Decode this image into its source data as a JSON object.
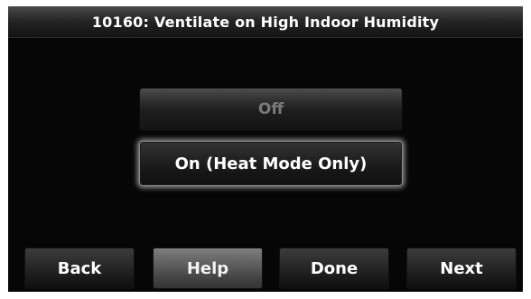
{
  "header": {
    "title": "10160: Ventilate on High Indoor Humidity"
  },
  "options": [
    {
      "label": "Off",
      "selected": false
    },
    {
      "label": "On (Heat Mode Only)",
      "selected": true
    }
  ],
  "nav": {
    "back_label": "Back",
    "help_label": "Help",
    "done_label": "Done",
    "next_label": "Next"
  }
}
